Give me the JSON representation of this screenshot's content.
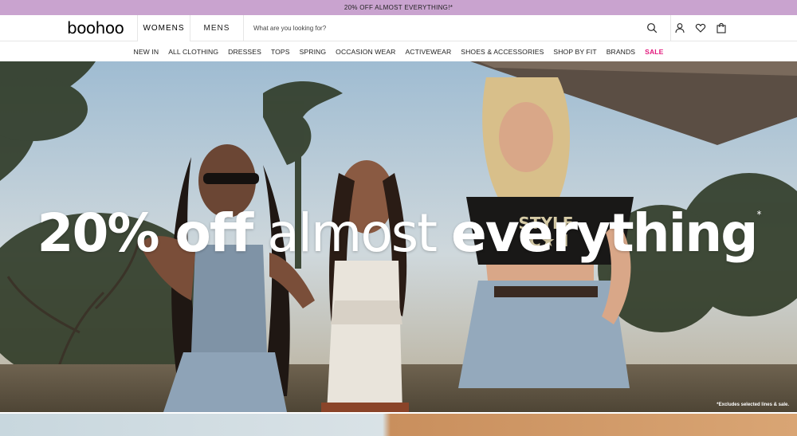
{
  "promo": {
    "text": "20% OFF ALMOST EVERYTHING!*"
  },
  "header": {
    "logo": "boohoo",
    "tabs": [
      {
        "label": "WOMENS"
      },
      {
        "label": "MENS"
      }
    ],
    "search": {
      "placeholder": "What are you looking for?"
    },
    "icons": [
      "search-icon",
      "account-icon",
      "heart-icon",
      "bag-icon"
    ]
  },
  "nav": {
    "items": [
      {
        "label": "NEW IN"
      },
      {
        "label": "ALL CLOTHING"
      },
      {
        "label": "DRESSES"
      },
      {
        "label": "TOPS"
      },
      {
        "label": "SPRING"
      },
      {
        "label": "OCCASION WEAR"
      },
      {
        "label": "ACTIVEWEAR"
      },
      {
        "label": "SHOES & ACCESSORIES"
      },
      {
        "label": "SHOP BY FIT"
      },
      {
        "label": "BRANDS"
      },
      {
        "label": "SALE"
      }
    ]
  },
  "hero": {
    "headline_part1": "20% off",
    "headline_part2": "almost",
    "headline_part3": "everything",
    "headline_mark": "*",
    "disclaimer": "*Excludes selected lines & sale.",
    "tshirt_text_line1": "STYLE",
    "tshirt_text_line2": "IC★N"
  },
  "colors": {
    "promo_bg": "#c9a3cf",
    "sale": "#e2187c"
  }
}
